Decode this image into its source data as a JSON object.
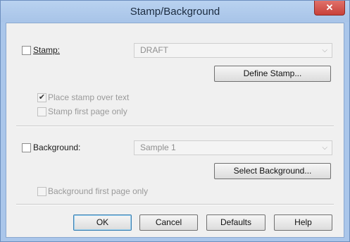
{
  "window": {
    "title": "Stamp/Background",
    "close_symbol": "✕"
  },
  "stamp": {
    "checkbox_label": "Stamp:",
    "checked": false,
    "select_value": "DRAFT",
    "define_button": "Define Stamp...",
    "place_over_text_label": "Place stamp over text",
    "place_over_text_checked": true,
    "first_page_only_label": "Stamp first page only",
    "first_page_only_checked": false
  },
  "background": {
    "checkbox_label": "Background:",
    "checked": false,
    "select_value": "Sample 1",
    "select_button": "Select Background...",
    "first_page_only_label": "Background first page only",
    "first_page_only_checked": false
  },
  "buttons": {
    "ok": "OK",
    "cancel": "Cancel",
    "defaults": "Defaults",
    "help": "Help"
  },
  "icons": {
    "check": "✔",
    "chevron": "⌵"
  },
  "colors": {
    "title_bar": "#aac6ea",
    "close": "#c8413a",
    "dialog_bg": "#f0f0f0"
  }
}
